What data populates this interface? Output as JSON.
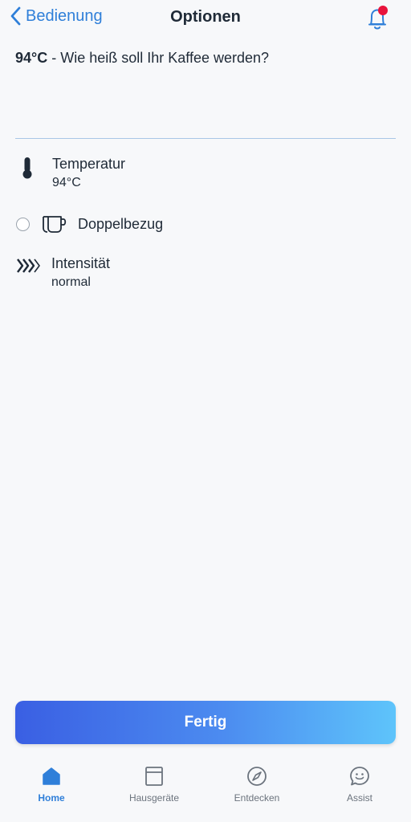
{
  "nav": {
    "back_label": "Bedienung",
    "title": "Optionen",
    "has_notification": true
  },
  "prompt": {
    "value": "94°C",
    "question": " - Wie heiß soll Ihr Kaffee werden?"
  },
  "options": {
    "temperature": {
      "label": "Temperatur",
      "value": "94°C",
      "icon": "thermometer-icon"
    },
    "double": {
      "label": "Doppelbezug",
      "icon": "double-cup-icon",
      "checked": false
    },
    "intensity": {
      "label": "Intensität",
      "value": "normal",
      "icon": "intensity-chevrons-icon"
    }
  },
  "done_button": {
    "label": "Fertig"
  },
  "tabbar": {
    "tabs": [
      {
        "label": "Home",
        "icon": "home-icon",
        "active": true
      },
      {
        "label": "Hausgeräte",
        "icon": "appliance-icon",
        "active": false
      },
      {
        "label": "Entdecken",
        "icon": "compass-icon",
        "active": false
      },
      {
        "label": "Assist",
        "icon": "assist-smiley-icon",
        "active": false
      }
    ]
  },
  "colors": {
    "accent": "#2f7fd9",
    "notification": "#e8143c",
    "button_gradient_start": "#3a5fe3",
    "button_gradient_end": "#5ec4fb"
  }
}
